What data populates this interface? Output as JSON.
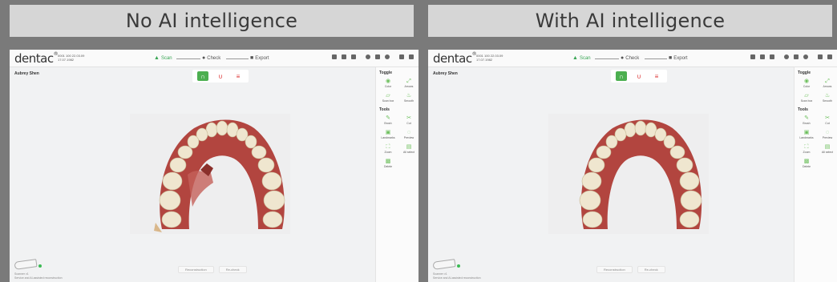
{
  "panels": [
    {
      "title": "No AI intelligence",
      "app": {
        "logo": "dentac",
        "logo_sup": "®",
        "meta_line1": "0001 100 22.03.09",
        "meta_line2": "17.07.1982",
        "steps": [
          {
            "icon": "scan-icon",
            "label": "Scan",
            "active": true
          },
          {
            "icon": "check-icon",
            "label": "Check",
            "active": false
          },
          {
            "icon": "export-icon",
            "label": "Export",
            "active": false
          }
        ],
        "patient_name": "Aubrey Shen",
        "jaw_toggle_active": "upper-jaw",
        "toggle_section": "Toggle",
        "toggle_items": [
          "Color",
          "Arrows",
          "Scan box",
          "Smooth"
        ],
        "tools_section": "Tools",
        "tools_items": [
          "Brush",
          "Cut",
          "Landmarks",
          "Preview",
          "Zoom",
          "All select",
          "Delete"
        ],
        "footer_text_line1": "Scanner v1",
        "footer_text_line2": "Service and AI-assisted reconstruction",
        "footer_buttons": [
          "Reconstruction",
          "Re-check"
        ],
        "scan_quality": "rough"
      }
    },
    {
      "title": "With AI intelligence",
      "app": {
        "logo": "dentac",
        "logo_sup": "®",
        "meta_line1": "0001 100 22.03.09",
        "meta_line2": "17.07.1982",
        "steps": [
          {
            "icon": "scan-icon",
            "label": "Scan",
            "active": true
          },
          {
            "icon": "check-icon",
            "label": "Check",
            "active": false
          },
          {
            "icon": "export-icon",
            "label": "Export",
            "active": false
          }
        ],
        "patient_name": "Aubrey Shen",
        "jaw_toggle_active": "upper-jaw",
        "toggle_section": "Toggle",
        "toggle_items": [
          "Color",
          "Arrows",
          "Scan box",
          "Smooth"
        ],
        "tools_section": "Tools",
        "tools_items": [
          "Brush",
          "Cut",
          "Landmarks",
          "Preview",
          "Zoom",
          "All select",
          "Delete"
        ],
        "footer_text_line1": "Scanner v1",
        "footer_text_line2": "Service and AI-assisted reconstruction",
        "footer_buttons": [
          "Reconstruction",
          "Re-check"
        ],
        "scan_quality": "clean"
      }
    }
  ],
  "colors": {
    "accent": "#3aa655",
    "gum": "#b2453f",
    "tooth": "#efe6cf",
    "status_dot": "#3cba54"
  }
}
